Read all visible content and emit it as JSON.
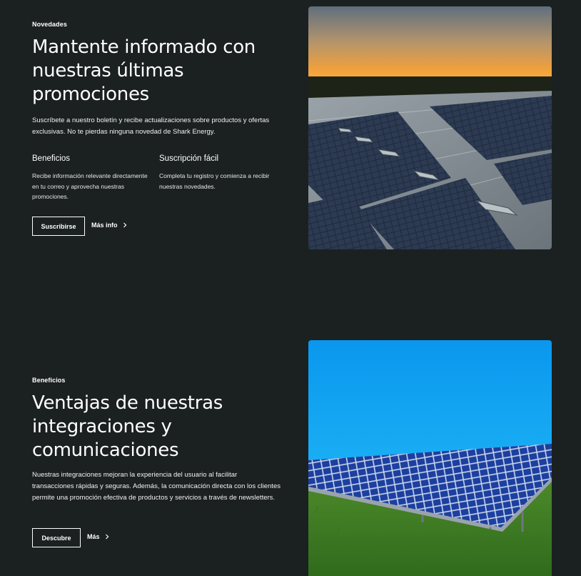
{
  "promo": {
    "tagline": "Novedades",
    "heading": "Mantente informado con nuestras últimas promociones",
    "body": "Suscríbete a nuestro boletín y recibe actualizaciones sobre productos y ofertas exclusivas. No te pierdas ninguna novedad de Shark Energy.",
    "features": [
      {
        "title": "Beneficios",
        "text": "Recibe información relevante directamente en tu correo y aprovecha nuestras promociones."
      },
      {
        "title": "Suscripción fácil",
        "text": "Completa tu registro y comienza a recibir nuestras novedades."
      }
    ],
    "primary_button": "Suscribirse",
    "secondary_link": "Más info",
    "image_icon": "rooftop-solar-panels-sunset-photo"
  },
  "benefits": {
    "tagline": "Beneficios",
    "heading": "Ventajas de nuestras integraciones y comunicaciones",
    "body": "Nuestras integraciones mejoran la experiencia del usuario al facilitar transacciones rápidas y seguras. Además, la comunicación directa con los clientes permite una promoción efectiva de productos y servicios a través de newsletters.",
    "primary_button": "Descubre",
    "secondary_link": "Más",
    "image_icon": "field-solar-panels-blue-sky-photo"
  },
  "colors": {
    "background": "#1b2021",
    "text": "#ffffff",
    "button_border": "#ffffff"
  }
}
